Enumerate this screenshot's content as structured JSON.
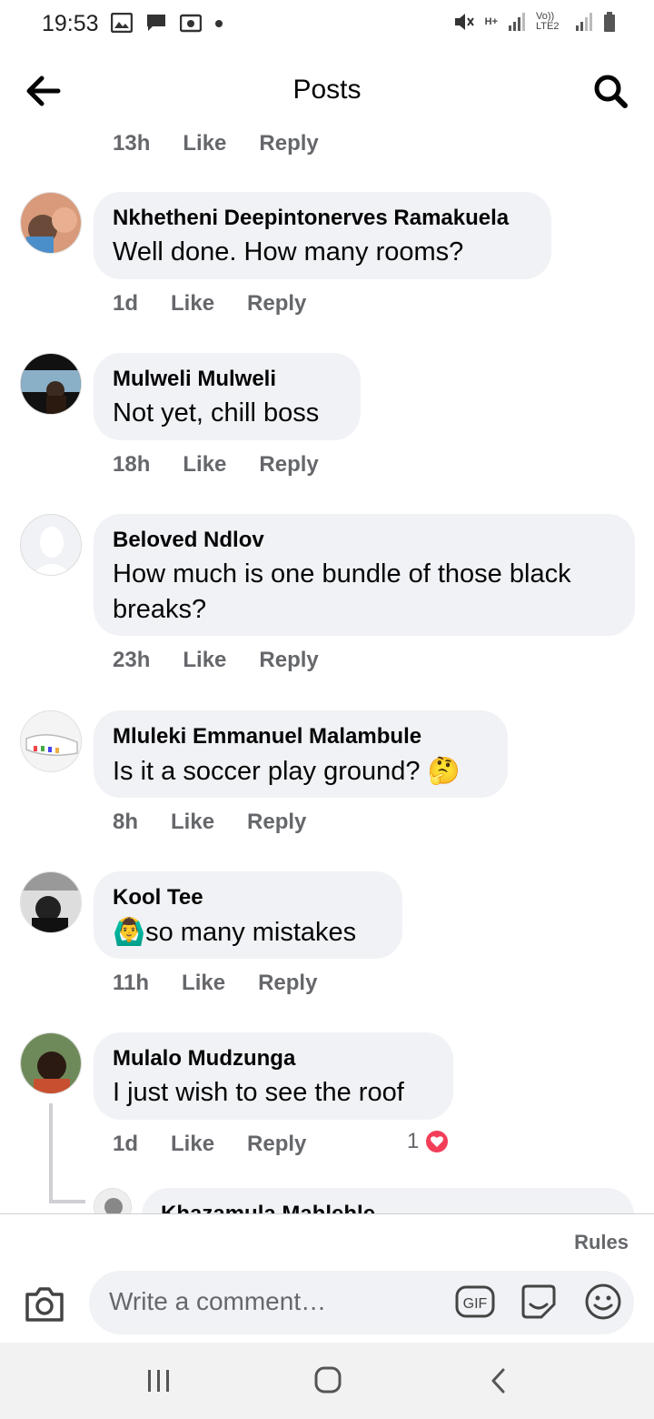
{
  "status_bar": {
    "time": "19:53",
    "left_icons": [
      "gallery-icon",
      "message-icon",
      "radio-icon",
      "dot-icon"
    ],
    "right_icons": [
      "mute-icon",
      "network-hplus-icon",
      "signal-icon",
      "volte-icon",
      "signal-icon",
      "battery-icon"
    ],
    "network_label": "H+",
    "volte_label": "Vo)) LTE2"
  },
  "header": {
    "title": "Posts",
    "back_icon": "arrow-left-icon",
    "search_icon": "search-icon"
  },
  "top_meta": {
    "time": "13h",
    "like": "Like",
    "reply": "Reply"
  },
  "comments": [
    {
      "author": "Nkhetheni Deepintonerves Ramakuela",
      "text": "Well done. How many rooms?",
      "time": "1d",
      "like": "Like",
      "reply": "Reply"
    },
    {
      "author": "Mulweli Mulweli",
      "text": "Not yet, chill boss",
      "time": "18h",
      "like": "Like",
      "reply": "Reply"
    },
    {
      "author": "Beloved Ndlov",
      "text": "How much is one bundle of those black breaks?",
      "time": "23h",
      "like": "Like",
      "reply": "Reply"
    },
    {
      "author": "Mluleki Emmanuel Malambule",
      "text": "Is it a soccer play ground?",
      "emoji": "🤔",
      "time": "8h",
      "like": "Like",
      "reply": "Reply"
    },
    {
      "author": "Kool Tee",
      "text": "so many mistakes",
      "emoji_prefix": "🙆‍♂️",
      "time": "11h",
      "like": "Like",
      "reply": "Reply"
    },
    {
      "author": "Mulalo Mudzunga",
      "text": "I just wish to see the roof",
      "time": "1d",
      "like": "Like",
      "reply": "Reply",
      "reaction_count": "1",
      "reaction": "heart-icon"
    }
  ],
  "reply_preview": {
    "author": "Khazamula Mahlehle"
  },
  "composer": {
    "rules": "Rules",
    "placeholder": "Write a comment…",
    "camera_icon": "camera-icon",
    "gif_label": "GIF",
    "sticker_icon": "sticker-icon",
    "emoji_icon": "emoji-icon"
  },
  "nav": {
    "recent_icon": "recent-apps-icon",
    "home_icon": "home-icon",
    "back_icon": "back-icon"
  },
  "colors": {
    "bubble": "#f0f2f5",
    "meta": "#65676b",
    "heart": "#f33e58",
    "navbar": "#f2f2f2"
  }
}
